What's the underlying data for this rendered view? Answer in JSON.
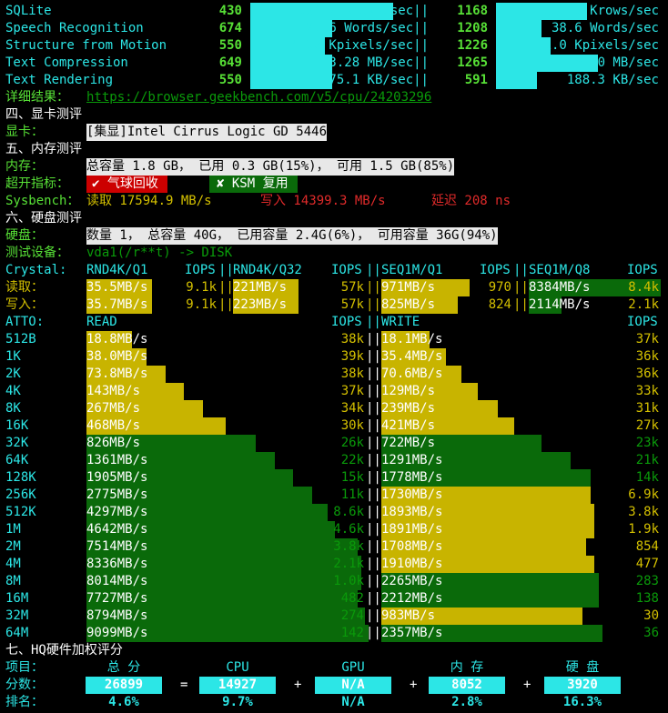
{
  "geekbench_rows": [
    {
      "name": "SQLite",
      "score": "430",
      "value": "134.7 Krows/sec||",
      "score2": "1168",
      "value2": "365.9 Krows/sec"
    },
    {
      "name": "Speech Recognition",
      "score": "674",
      "value": "21.6 Words/sec||",
      "score2": "1208",
      "value2": "38.6 Words/sec"
    },
    {
      "name": "Structure from Motion",
      "score": "550",
      "value": "4.92 Kpixels/sec||",
      "score2": "1226",
      "value2": "11.0 Kpixels/sec"
    },
    {
      "name": "Text Compression",
      "score": "649",
      "value": "3.28 MB/sec||",
      "score2": "1265",
      "value2": "6.40 MB/sec"
    },
    {
      "name": "Text Rendering",
      "score": "550",
      "value": "175.1 KB/sec||",
      "score2": "591",
      "value2": "188.3 KB/sec"
    }
  ],
  "result_label": "详细结果：",
  "result_url": "https://browser.geekbench.com/v5/cpu/24203296",
  "gpu_section": "四、显卡测评",
  "gpu_label": "显卡：",
  "gpu_value": "[集显]Intel Cirrus Logic GD 5446",
  "mem_section": "五、内存测评",
  "mem_label": "内存：",
  "mem_value": "总容量 1.8 GB， 已用 0.3 GB(15%)， 可用 1.5 GB(85%)",
  "overcommit_label": "超开指标：",
  "balloon": "✔ 气球回收",
  "ksm": "✘ KSM 复用",
  "sysbench_label": "Sysbench：",
  "sysbench_read": "读取 17594.9 MB/s",
  "sysbench_write": "写入 14399.3 MB/s",
  "sysbench_latency": "延迟 208 ns",
  "disk_section": "六、硬盘测评",
  "disk_label": "硬盘：",
  "disk_value": "数量 1， 总容量 40G， 已用容量 2.4G(6%)， 可用容量 36G(94%)",
  "test_dev_label": "测试设备：",
  "test_dev_value": "vda1(/r**t) -> DISK",
  "crystal": {
    "label": "Crystal:",
    "h1": "RND4K/Q1",
    "h1i": "IOPS",
    "h2": "RND4K/Q32",
    "h2i": "IOPS",
    "h3": "SEQ1M/Q1",
    "h3i": "IOPS",
    "h4": "SEQ1M/Q8",
    "h4i": "IOPS",
    "read_label": "读取：",
    "write_label": "写入：",
    "read": [
      "35.5MB/s",
      "9.1k",
      "221MB/s",
      "57k",
      "971MB/s",
      "970",
      "8384MB/s",
      "8.4k"
    ],
    "write": [
      "35.7MB/s",
      "9.1k",
      "223MB/s",
      "57k",
      "825MB/s",
      "824",
      "2114MB/s",
      "2.1k"
    ],
    "read_fill": [
      0.004,
      0.004,
      0.9,
      1.0
    ],
    "write_fill": [
      0.004,
      0.004,
      0.78,
      0.25
    ]
  },
  "atto": {
    "label": "ATTO:",
    "read_h": "READ",
    "iops_h": "IOPS",
    "write_h": "WRITE",
    "iops_h2": "IOPS",
    "rows": [
      {
        "size": "512B",
        "r": "18.8MB/s",
        "ri": "38k",
        "w": "18.1MB/s",
        "wi": "37k",
        "rf": 0.12,
        "wf": 0.12,
        "rc": "y",
        "wc": "y"
      },
      {
        "size": "1K",
        "r": "38.0MB/s",
        "ri": "39k",
        "w": "35.4MB/s",
        "wi": "36k",
        "rf": 0.16,
        "wf": 0.16,
        "rc": "y",
        "wc": "y"
      },
      {
        "size": "2K",
        "r": "73.8MB/s",
        "ri": "38k",
        "w": "70.6MB/s",
        "wi": "36k",
        "rf": 0.21,
        "wf": 0.2,
        "rc": "y",
        "wc": "y"
      },
      {
        "size": "4K",
        "r": "143MB/s",
        "ri": "37k",
        "w": "129MB/s",
        "wi": "33k",
        "rf": 0.26,
        "wf": 0.24,
        "rc": "y",
        "wc": "y"
      },
      {
        "size": "8K",
        "r": "267MB/s",
        "ri": "34k",
        "w": "239MB/s",
        "wi": "31k",
        "rf": 0.31,
        "wf": 0.29,
        "rc": "y",
        "wc": "y"
      },
      {
        "size": "16K",
        "r": "468MB/s",
        "ri": "30k",
        "w": "421MB/s",
        "wi": "27k",
        "rf": 0.37,
        "wf": 0.33,
        "rc": "y",
        "wc": "y"
      },
      {
        "size": "32K",
        "r": "826MB/s",
        "ri": "26k",
        "w": "722MB/s",
        "wi": "23k",
        "rf": 0.45,
        "wf": 0.4,
        "rc": "g",
        "wc": "g"
      },
      {
        "size": "64K",
        "r": "1361MB/s",
        "ri": "22k",
        "w": "1291MB/s",
        "wi": "21k",
        "rf": 0.5,
        "wf": 0.47,
        "rc": "g",
        "wc": "g"
      },
      {
        "size": "128K",
        "r": "1905MB/s",
        "ri": "15k",
        "w": "1778MB/s",
        "wi": "14k",
        "rf": 0.55,
        "wf": 0.52,
        "rc": "g",
        "wc": "g"
      },
      {
        "size": "256K",
        "r": "2775MB/s",
        "ri": "11k",
        "w": "1730MB/s",
        "wi": "6.9k",
        "rf": 0.6,
        "wf": 0.52,
        "rc": "g",
        "wc": "y"
      },
      {
        "size": "512K",
        "r": "4297MB/s",
        "ri": "8.6k",
        "w": "1893MB/s",
        "wi": "3.8k",
        "rf": 0.64,
        "wf": 0.53,
        "rc": "g",
        "wc": "y"
      },
      {
        "size": "1M",
        "r": "4642MB/s",
        "ri": "4.6k",
        "w": "1891MB/s",
        "wi": "1.9k",
        "rf": 0.66,
        "wf": 0.53,
        "rc": "g",
        "wc": "y"
      },
      {
        "size": "2M",
        "r": "7514MB/s",
        "ri": "3.8k",
        "w": "1708MB/s",
        "wi": "854",
        "rf": 0.72,
        "wf": 0.51,
        "rc": "g",
        "wc": "y"
      },
      {
        "size": "4M",
        "r": "8336MB/s",
        "ri": "2.1k",
        "w": "1910MB/s",
        "wi": "477",
        "rf": 0.73,
        "wf": 0.53,
        "rc": "g",
        "wc": "y"
      },
      {
        "size": "8M",
        "r": "8014MB/s",
        "ri": "1.0k",
        "w": "2265MB/s",
        "wi": "283",
        "rf": 0.73,
        "wf": 0.54,
        "rc": "g",
        "wc": "g"
      },
      {
        "size": "16M",
        "r": "7727MB/s",
        "ri": "482",
        "w": "2212MB/s",
        "wi": "138",
        "rf": 0.72,
        "wf": 0.54,
        "rc": "g",
        "wc": "g"
      },
      {
        "size": "32M",
        "r": "8794MB/s",
        "ri": "274",
        "w": "983MB/s",
        "wi": "30",
        "rf": 0.74,
        "wf": 0.5,
        "rc": "g",
        "wc": "y"
      },
      {
        "size": "64M",
        "r": "9099MB/s",
        "ri": "142",
        "w": "2357MB/s",
        "wi": "36",
        "rf": 0.75,
        "wf": 0.55,
        "rc": "g",
        "wc": "g"
      }
    ]
  },
  "hq_section": "七、HQ硬件加权评分",
  "hq": {
    "item_label": "项目：",
    "score_label": "分数：",
    "rank_label": "排名：",
    "cols": [
      "总 分",
      "CPU",
      "GPU",
      "内 存",
      "硬 盘"
    ],
    "scores": [
      "26899",
      "14927",
      "N/A",
      "8052",
      "3920"
    ],
    "ops": [
      "=",
      "+",
      "+",
      "+"
    ],
    "ranks": [
      "4.6%",
      "9.7%",
      "N/A",
      "2.8%",
      "16.3%"
    ]
  },
  "colors": {
    "cyan": "#2ce6e6",
    "yellow": "#c8b400",
    "green": "#0a6a0a"
  }
}
